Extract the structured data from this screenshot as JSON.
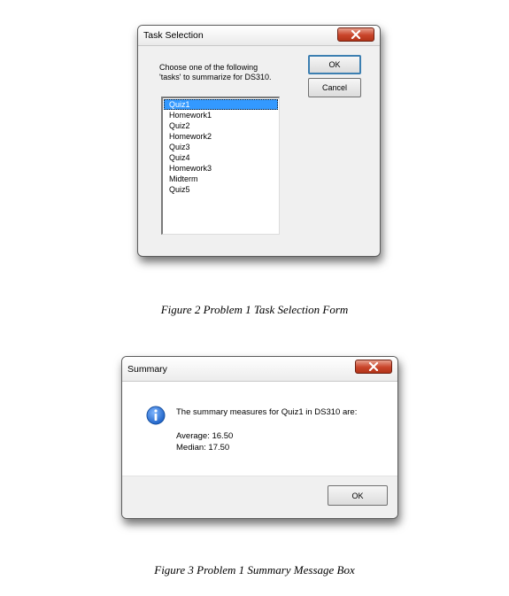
{
  "task_selection": {
    "title": "Task Selection",
    "prompt_line1": "Choose one of the following",
    "prompt_line2": "'tasks' to summarize for DS310.",
    "ok_label": "OK",
    "cancel_label": "Cancel",
    "tasks": [
      "Quiz1",
      "Homework1",
      "Quiz2",
      "Homework2",
      "Quiz3",
      "Quiz4",
      "Homework3",
      "Midterm",
      "Quiz5"
    ],
    "selected_task": "Quiz1"
  },
  "caption_fig2": "Figure 2 Problem 1 Task Selection Form",
  "summary": {
    "title": "Summary",
    "message": "The summary measures for Quiz1 in DS310 are:",
    "average": "Average: 16.50",
    "median": "Median: 17.50",
    "ok_label": "OK"
  },
  "caption_fig3": "Figure 3 Problem 1 Summary Message Box",
  "colors": {
    "selection": "#3399ff",
    "close_button": "#c9442a",
    "info_icon": "#1f63c7"
  },
  "icons": [
    "close-icon",
    "info-icon"
  ]
}
